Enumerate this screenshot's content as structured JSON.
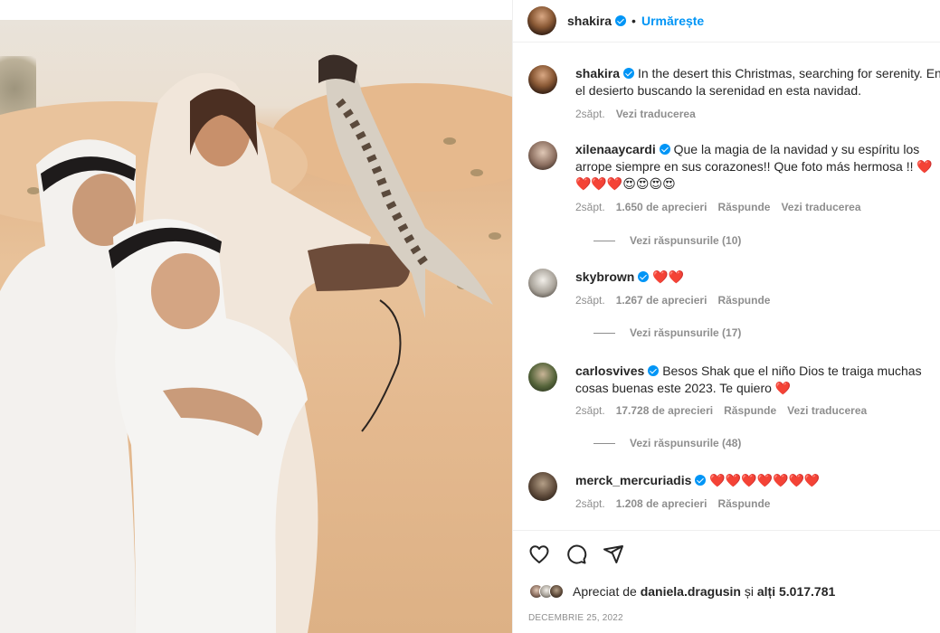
{
  "post": {
    "author": "shakira",
    "follow_label": "Urmărește",
    "dot": "•"
  },
  "comments": [
    {
      "user": "shakira",
      "text": "In the desert this Christmas, searching for serenity. En el desierto buscando la serenidad en esta navidad.",
      "time": "2săpt.",
      "translate": "Vezi traducerea"
    },
    {
      "user": "xilenaaycardi",
      "text": "Que la magia de la navidad y su espíritu los arrope siempre en sus corazones!! Que foto más hermosa !! ❤️❤️❤️❤️😍😍😍😍",
      "time": "2săpt.",
      "likes": "1.650 de aprecieri",
      "reply": "Răspunde",
      "translate": "Vezi traducerea",
      "view_replies": "Vezi răspunsurile (10)"
    },
    {
      "user": "skybrown",
      "text": "❤️❤️",
      "time": "2săpt.",
      "likes": "1.267 de aprecieri",
      "reply": "Răspunde",
      "view_replies": "Vezi răspunsurile (17)"
    },
    {
      "user": "carlosvives",
      "text": "Besos Shak que el niño Dios te traiga muchas cosas buenas este 2023. Te quiero ❤️",
      "time": "2săpt.",
      "likes": "17.728 de aprecieri",
      "reply": "Răspunde",
      "translate": "Vezi traducerea",
      "view_replies": "Vezi răspunsurile (48)"
    },
    {
      "user": "merck_mercuriadis",
      "text": "❤️❤️❤️❤️❤️❤️❤️",
      "time": "2săpt.",
      "likes": "1.208 de aprecieri",
      "reply": "Răspunde"
    }
  ],
  "liked_by": {
    "prefix": "Apreciat de",
    "user": "daniela.dragusin",
    "middle": "și",
    "others": "alți 5.017.781"
  },
  "date": "DECEMBRIE 25, 2022",
  "icons": {
    "like": "heart-icon",
    "comment": "comment-icon",
    "share": "share-icon",
    "verified": "verified-badge-icon"
  }
}
